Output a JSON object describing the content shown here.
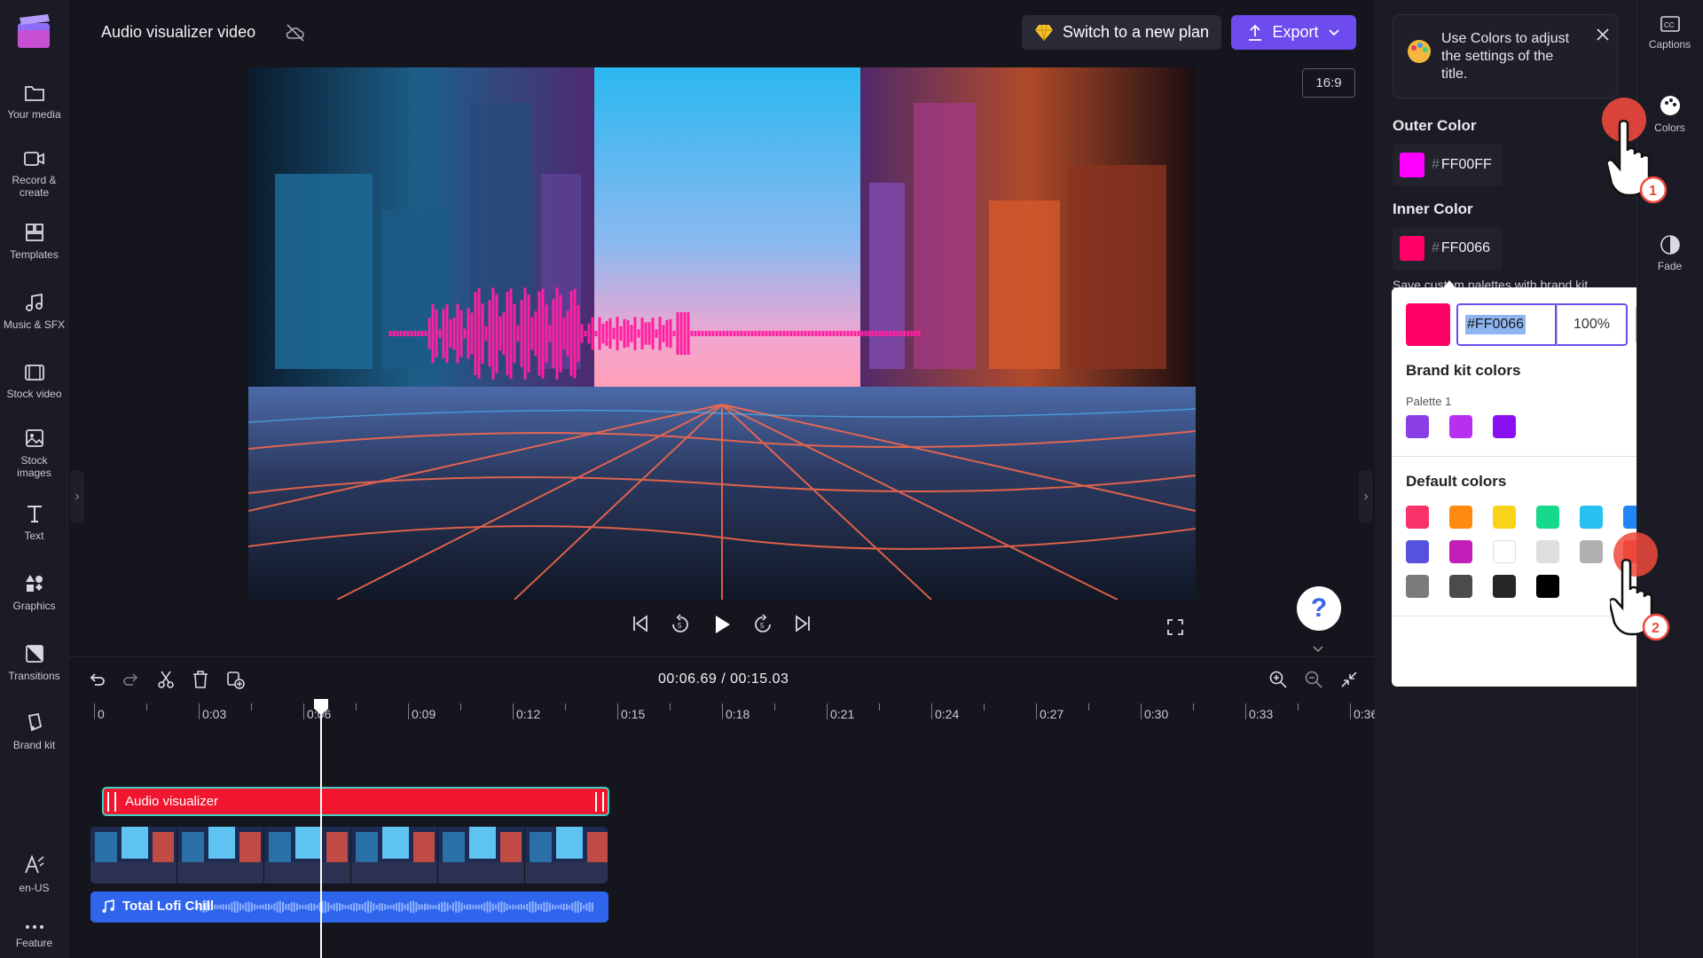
{
  "project": {
    "title": "Audio visualizer video"
  },
  "nav": {
    "items": [
      {
        "label": "Your media",
        "icon": "folder-icon"
      },
      {
        "label": "Record &\ncreate",
        "icon": "camera-icon"
      },
      {
        "label": "Templates",
        "icon": "templates-icon"
      },
      {
        "label": "Music & SFX",
        "icon": "music-icon"
      },
      {
        "label": "Stock video",
        "icon": "film-icon"
      },
      {
        "label": "Stock\nimages",
        "icon": "image-icon"
      },
      {
        "label": "Text",
        "icon": "text-icon"
      },
      {
        "label": "Graphics",
        "icon": "shapes-icon"
      },
      {
        "label": "Transitions",
        "icon": "transitions-icon"
      },
      {
        "label": "Brand kit",
        "icon": "brand-icon"
      },
      {
        "label": "en-US",
        "icon": "language-icon"
      },
      {
        "label": "Feature",
        "icon": "more-icon"
      }
    ]
  },
  "header": {
    "plan_label": "Switch to a new plan",
    "export_label": "Export",
    "aspect_ratio": "16:9"
  },
  "help": {
    "label": "?"
  },
  "timecode": {
    "current": "00:06.69",
    "separator": "/",
    "total": "00:15.03"
  },
  "ruler": {
    "labels": [
      "0",
      "0:03",
      "0:06",
      "0:09",
      "0:12",
      "0:15",
      "0:18",
      "0:21",
      "0:24",
      "0:27",
      "0:30",
      "0:33",
      "0:36"
    ]
  },
  "tracks": {
    "visualizer_label": "Audio visualizer",
    "audio_label": "Total Lofi Chill"
  },
  "tip": {
    "text": "Use Colors to adjust the settings of the title."
  },
  "panel": {
    "outer_label": "Outer Color",
    "outer_hex": "FF00FF",
    "outer_color": "#FF00FF",
    "inner_label": "Inner Color",
    "inner_hex": "FF0066",
    "inner_color": "#FF0066",
    "save_hint": "Save custom palettes with brand kit",
    "hash": "#"
  },
  "picker": {
    "hex_value": "#FF0066",
    "opacity": "100%",
    "brand_title": "Brand kit colors",
    "palette_label": "Palette 1",
    "brand_colors": [
      "#8a3ee6",
      "#b92ff0",
      "#8a0ff2"
    ],
    "default_title": "Default colors",
    "default_colors": [
      "#f7326a",
      "#ff8a10",
      "#f7d418",
      "#17d98c",
      "#27c1f0",
      "#1f86f5",
      "#5652de",
      "#c41fb8",
      "#ffffff",
      "#dedede",
      "#b0b0b0",
      "#f0453a",
      "#7b7b7b",
      "#4b4b4b",
      "#262626",
      "#000000"
    ]
  },
  "rail": {
    "captions_label": "Captions",
    "colors_label": "Colors",
    "fade_label": "Fade"
  },
  "steps": {
    "one": "1",
    "two": "2"
  }
}
